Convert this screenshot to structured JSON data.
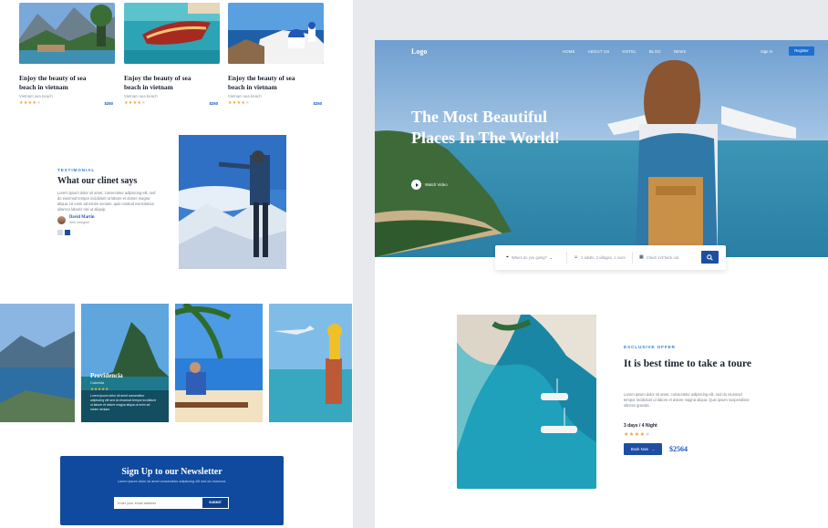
{
  "cards": [
    {
      "title": "Enjoy the beauty of sea beach in vietnam",
      "location": "Vietnam sea beach",
      "rating": 4,
      "price": "$250"
    },
    {
      "title": "Enjoy the beauty of sea beach in vietnam",
      "location": "Vietnam sea beach",
      "rating": 4,
      "price": "$250"
    },
    {
      "title": "Enjoy the beauty of sea beach in vietnam",
      "location": "Vietnam sea beach",
      "rating": 4,
      "price": "$250"
    }
  ],
  "testimonial": {
    "eyebrow": "TESTIMONIAL",
    "title": "What our clinet says",
    "body": "Lorem ipsum dolor sit amet, consectetur adipiscing elit, sed do eiusmod tempor incididunt ut labore et dolore magna aliqua. Ut enim ad minim veniam, quis nostrud exercitation ullamco laboris nisi ut aliquip.",
    "author_name": "David Martin",
    "author_role": "Web designer"
  },
  "gallery": {
    "feature_name": "Providencia",
    "feature_sub": "Colombia",
    "feature_rating": 5,
    "feature_body": "Lorem ipsum dolor sit amet consectetur adipiscing elit sed do eiusmod tempor incididunt ut labore et dolore magna aliqua ut enim ad minim veniam."
  },
  "newsletter": {
    "title": "Sign Up to our Newsletter",
    "subtitle": "Lorem ipsum dolor sit amet consectetur adipiscing elit sed do eiusmod.",
    "placeholder": "Enter your email address",
    "button": "SUBMIT"
  },
  "site": {
    "logo": "Logo",
    "nav": [
      "HOME",
      "ABOUT US",
      "HOTEL",
      "BLOG",
      "NEWS"
    ],
    "signin": "Sign In",
    "register": "Register",
    "hero_title": "The Most Beautiful Places In The World!",
    "watch_video": "Watch Video",
    "search": {
      "where": "Where do you going?",
      "guests": "2 adults, 2 villages, 1 room",
      "dates": "Check in/Check out"
    }
  },
  "offer": {
    "eyebrow": "EXCLUSIVE OFFER",
    "title": "It is best time to take a toure",
    "body": "Lorem ipsum dolor sit amet, consectetur adipiscing elit, sed do eiusmod tempor incididunt ut labore et dolore magna aliqua. Quis ipsum suspendisse ultrices gravida.",
    "days": "3 days / 4 Night",
    "rating": 4,
    "book": "Book Now",
    "price": "$2564"
  },
  "colors": {
    "brand_blue": "#1c4fa1",
    "accent_blue": "#2d7fd3",
    "star": "#f1a62e",
    "newsletter_bg": "#0f4a9e"
  }
}
